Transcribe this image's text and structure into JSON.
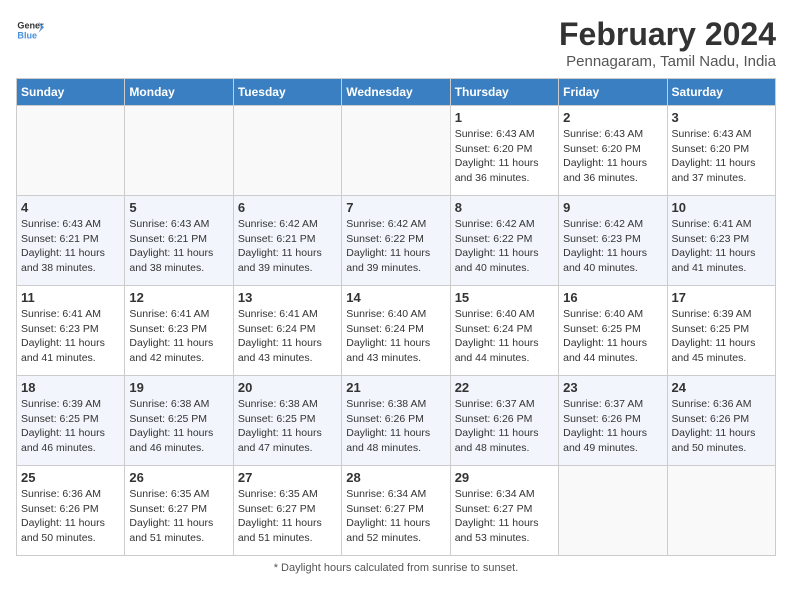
{
  "header": {
    "logo_line1": "General",
    "logo_line2": "Blue",
    "month_year": "February 2024",
    "location": "Pennagaram, Tamil Nadu, India"
  },
  "days_of_week": [
    "Sunday",
    "Monday",
    "Tuesday",
    "Wednesday",
    "Thursday",
    "Friday",
    "Saturday"
  ],
  "weeks": [
    [
      {
        "day": "",
        "detail": ""
      },
      {
        "day": "",
        "detail": ""
      },
      {
        "day": "",
        "detail": ""
      },
      {
        "day": "",
        "detail": ""
      },
      {
        "day": "1",
        "detail": "Sunrise: 6:43 AM\nSunset: 6:20 PM\nDaylight: 11 hours and 36 minutes."
      },
      {
        "day": "2",
        "detail": "Sunrise: 6:43 AM\nSunset: 6:20 PM\nDaylight: 11 hours and 36 minutes."
      },
      {
        "day": "3",
        "detail": "Sunrise: 6:43 AM\nSunset: 6:20 PM\nDaylight: 11 hours and 37 minutes."
      }
    ],
    [
      {
        "day": "4",
        "detail": "Sunrise: 6:43 AM\nSunset: 6:21 PM\nDaylight: 11 hours and 38 minutes."
      },
      {
        "day": "5",
        "detail": "Sunrise: 6:43 AM\nSunset: 6:21 PM\nDaylight: 11 hours and 38 minutes."
      },
      {
        "day": "6",
        "detail": "Sunrise: 6:42 AM\nSunset: 6:21 PM\nDaylight: 11 hours and 39 minutes."
      },
      {
        "day": "7",
        "detail": "Sunrise: 6:42 AM\nSunset: 6:22 PM\nDaylight: 11 hours and 39 minutes."
      },
      {
        "day": "8",
        "detail": "Sunrise: 6:42 AM\nSunset: 6:22 PM\nDaylight: 11 hours and 40 minutes."
      },
      {
        "day": "9",
        "detail": "Sunrise: 6:42 AM\nSunset: 6:23 PM\nDaylight: 11 hours and 40 minutes."
      },
      {
        "day": "10",
        "detail": "Sunrise: 6:41 AM\nSunset: 6:23 PM\nDaylight: 11 hours and 41 minutes."
      }
    ],
    [
      {
        "day": "11",
        "detail": "Sunrise: 6:41 AM\nSunset: 6:23 PM\nDaylight: 11 hours and 41 minutes."
      },
      {
        "day": "12",
        "detail": "Sunrise: 6:41 AM\nSunset: 6:23 PM\nDaylight: 11 hours and 42 minutes."
      },
      {
        "day": "13",
        "detail": "Sunrise: 6:41 AM\nSunset: 6:24 PM\nDaylight: 11 hours and 43 minutes."
      },
      {
        "day": "14",
        "detail": "Sunrise: 6:40 AM\nSunset: 6:24 PM\nDaylight: 11 hours and 43 minutes."
      },
      {
        "day": "15",
        "detail": "Sunrise: 6:40 AM\nSunset: 6:24 PM\nDaylight: 11 hours and 44 minutes."
      },
      {
        "day": "16",
        "detail": "Sunrise: 6:40 AM\nSunset: 6:25 PM\nDaylight: 11 hours and 44 minutes."
      },
      {
        "day": "17",
        "detail": "Sunrise: 6:39 AM\nSunset: 6:25 PM\nDaylight: 11 hours and 45 minutes."
      }
    ],
    [
      {
        "day": "18",
        "detail": "Sunrise: 6:39 AM\nSunset: 6:25 PM\nDaylight: 11 hours and 46 minutes."
      },
      {
        "day": "19",
        "detail": "Sunrise: 6:38 AM\nSunset: 6:25 PM\nDaylight: 11 hours and 46 minutes."
      },
      {
        "day": "20",
        "detail": "Sunrise: 6:38 AM\nSunset: 6:25 PM\nDaylight: 11 hours and 47 minutes."
      },
      {
        "day": "21",
        "detail": "Sunrise: 6:38 AM\nSunset: 6:26 PM\nDaylight: 11 hours and 48 minutes."
      },
      {
        "day": "22",
        "detail": "Sunrise: 6:37 AM\nSunset: 6:26 PM\nDaylight: 11 hours and 48 minutes."
      },
      {
        "day": "23",
        "detail": "Sunrise: 6:37 AM\nSunset: 6:26 PM\nDaylight: 11 hours and 49 minutes."
      },
      {
        "day": "24",
        "detail": "Sunrise: 6:36 AM\nSunset: 6:26 PM\nDaylight: 11 hours and 50 minutes."
      }
    ],
    [
      {
        "day": "25",
        "detail": "Sunrise: 6:36 AM\nSunset: 6:26 PM\nDaylight: 11 hours and 50 minutes."
      },
      {
        "day": "26",
        "detail": "Sunrise: 6:35 AM\nSunset: 6:27 PM\nDaylight: 11 hours and 51 minutes."
      },
      {
        "day": "27",
        "detail": "Sunrise: 6:35 AM\nSunset: 6:27 PM\nDaylight: 11 hours and 51 minutes."
      },
      {
        "day": "28",
        "detail": "Sunrise: 6:34 AM\nSunset: 6:27 PM\nDaylight: 11 hours and 52 minutes."
      },
      {
        "day": "29",
        "detail": "Sunrise: 6:34 AM\nSunset: 6:27 PM\nDaylight: 11 hours and 53 minutes."
      },
      {
        "day": "",
        "detail": ""
      },
      {
        "day": "",
        "detail": ""
      }
    ]
  ],
  "footer": "Daylight hours"
}
